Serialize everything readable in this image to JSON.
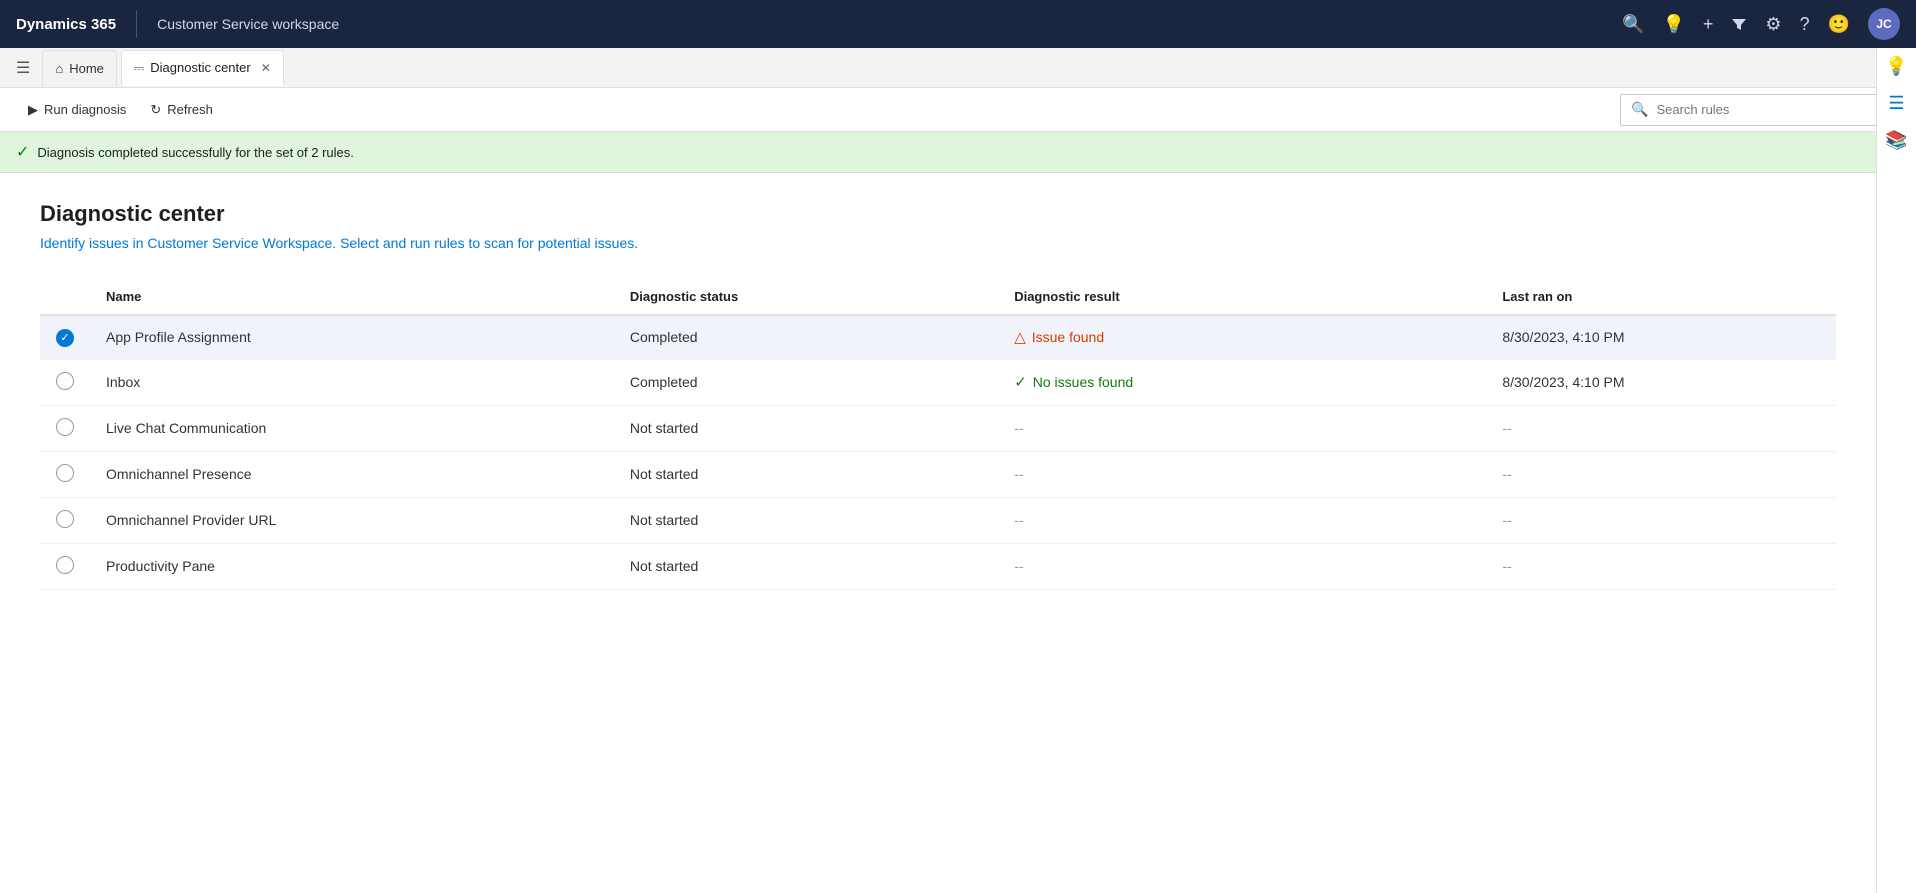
{
  "topNav": {
    "brand": "Dynamics 365",
    "app": "Customer Service workspace",
    "icons": [
      "search",
      "lightbulb",
      "plus",
      "filter",
      "settings",
      "help",
      "smiley"
    ],
    "avatar": "JC"
  },
  "tabs": [
    {
      "id": "home",
      "label": "Home",
      "icon": "home",
      "active": false,
      "closable": false
    },
    {
      "id": "diagnostic",
      "label": "Diagnostic center",
      "icon": "diagnostic",
      "active": true,
      "closable": true
    }
  ],
  "toolbar": {
    "runDiagnosis": "Run diagnosis",
    "refresh": "Refresh",
    "searchPlaceholder": "Search rules"
  },
  "banner": {
    "message": "Diagnosis completed successfully for the set of 2 rules."
  },
  "page": {
    "title": "Diagnostic center",
    "subtitle": "Identify issues in Customer Service Workspace. Select and run rules to scan for potential issues."
  },
  "table": {
    "headers": [
      "Name",
      "Diagnostic status",
      "Diagnostic result",
      "Last ran on"
    ],
    "rows": [
      {
        "id": 1,
        "checked": true,
        "name": "App Profile Assignment",
        "status": "Completed",
        "resultType": "issue",
        "result": "Issue found",
        "lastRan": "8/30/2023, 4:10 PM"
      },
      {
        "id": 2,
        "checked": false,
        "name": "Inbox",
        "status": "Completed",
        "resultType": "no-issue",
        "result": "No issues found",
        "lastRan": "8/30/2023, 4:10 PM"
      },
      {
        "id": 3,
        "checked": false,
        "name": "Live Chat Communication",
        "status": "Not started",
        "resultType": "none",
        "result": "--",
        "lastRan": "--"
      },
      {
        "id": 4,
        "checked": false,
        "name": "Omnichannel Presence",
        "status": "Not started",
        "resultType": "none",
        "result": "--",
        "lastRan": "--"
      },
      {
        "id": 5,
        "checked": false,
        "name": "Omnichannel Provider URL",
        "status": "Not started",
        "resultType": "none",
        "result": "--",
        "lastRan": "--"
      },
      {
        "id": 6,
        "checked": false,
        "name": "Productivity Pane",
        "status": "Not started",
        "resultType": "none",
        "result": "--",
        "lastRan": "--"
      }
    ]
  }
}
